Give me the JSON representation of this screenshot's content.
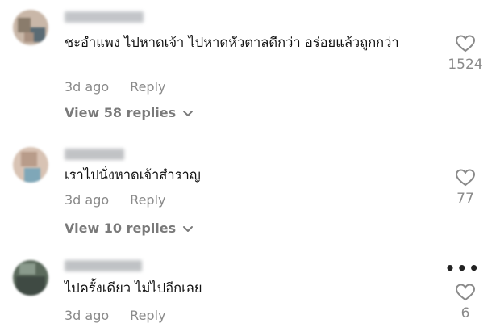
{
  "comments": [
    {
      "text": "ชะอำแพง ไปหาดเจ้า ไปหาดหัวตาลดีกว่า อร่อยแล้วถูกกว่า",
      "time": "3d ago",
      "reply_label": "Reply",
      "view_replies": "View 58 replies",
      "likes": "1524",
      "avatar_colors": [
        "#c9b7a8",
        "#8a7c6c",
        "#5a6b74"
      ],
      "username_color": "#b9bcc0"
    },
    {
      "text": "เราไปนั่งหาดเจ้าสำราญ",
      "time": "3d ago",
      "reply_label": "Reply",
      "view_replies": "View 10 replies",
      "likes": "77",
      "avatar_colors": [
        "#d8c3b4",
        "#b89c8a",
        "#7fa7b8"
      ],
      "username_color": "#b7b9bc"
    },
    {
      "text": "ไปครั้งเดียว ไม่ไปอีกเลย",
      "time": "3d ago",
      "reply_label": "Reply",
      "view_replies": "",
      "likes": "6",
      "more_icon": "•••",
      "avatar_colors": [
        "#5b6a5c",
        "#3f4a43",
        "#8a9a8c"
      ],
      "username_color": "#b5b8bb"
    }
  ]
}
